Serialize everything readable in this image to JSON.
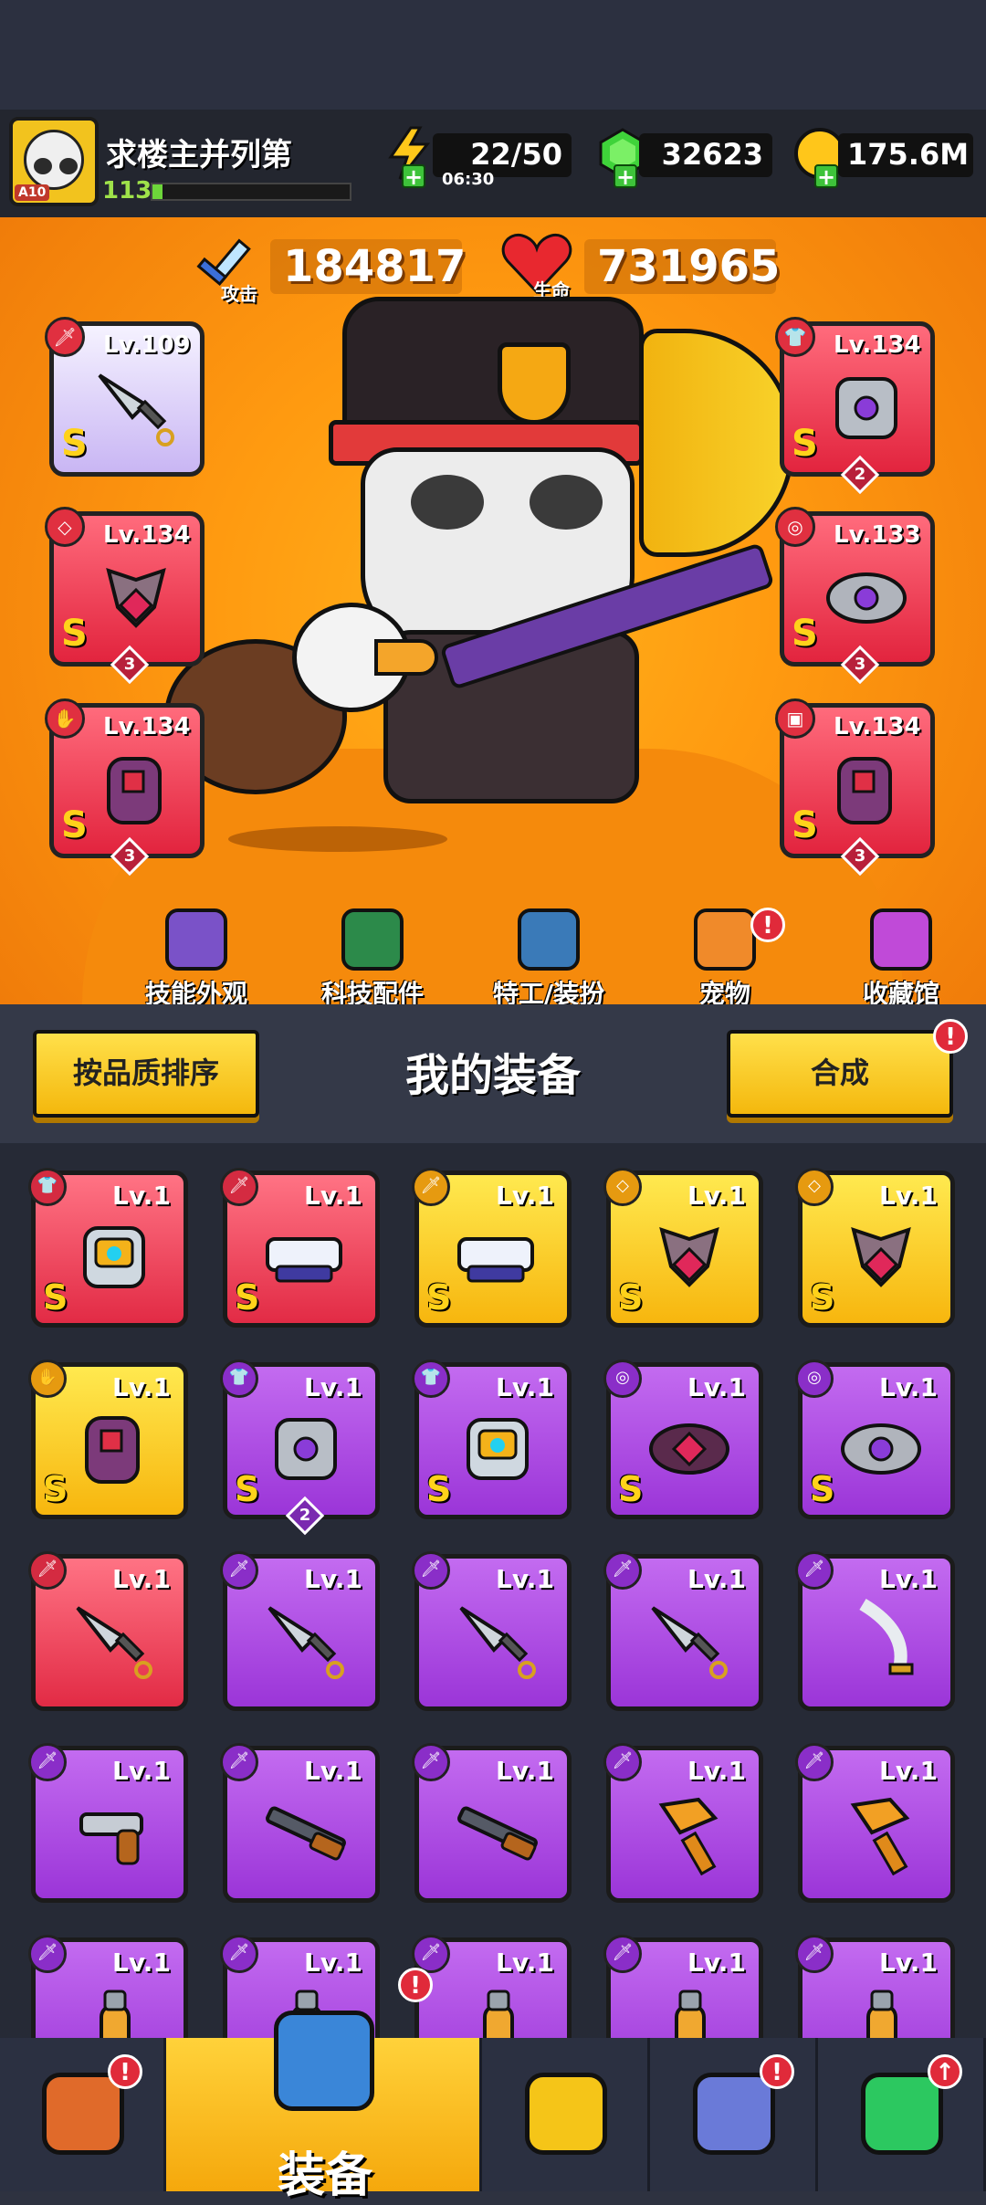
{
  "player": {
    "avatar_badge": "A10",
    "name": "求楼主并列第",
    "level": "113",
    "xp_fraction": 0.05
  },
  "resources": {
    "energy": {
      "value": "22/50",
      "timer": "06:30",
      "icon": "lightning-icon"
    },
    "gems": {
      "value": "32623",
      "icon": "green-gem-icon"
    },
    "gold": {
      "value": "175.6M",
      "icon": "gold-coin-icon"
    }
  },
  "stats": {
    "attack": {
      "label": "攻击",
      "value": "184817"
    },
    "hp": {
      "label": "生命",
      "value": "731965"
    }
  },
  "equipped": {
    "left": [
      {
        "lv": "Lv.109",
        "grade": "S",
        "slot": "weapon",
        "frame": "white"
      },
      {
        "lv": "Lv.134",
        "grade": "S",
        "slot": "necklace",
        "frame": "red",
        "count": "3"
      },
      {
        "lv": "Lv.134",
        "grade": "S",
        "slot": "glove",
        "frame": "red",
        "count": "3"
      }
    ],
    "right": [
      {
        "lv": "Lv.134",
        "grade": "S",
        "slot": "armor",
        "frame": "red",
        "count": "2"
      },
      {
        "lv": "Lv.133",
        "grade": "S",
        "slot": "belt",
        "frame": "red",
        "count": "3"
      },
      {
        "lv": "Lv.134",
        "grade": "S",
        "slot": "boots",
        "frame": "red",
        "count": "3"
      }
    ]
  },
  "hero_menu": [
    {
      "label": "技能外观",
      "icon": "skill-skin-icon",
      "badge": ""
    },
    {
      "label": "科技配件",
      "icon": "tech-part-icon",
      "badge": ""
    },
    {
      "label": "特工/装扮",
      "icon": "agent-costume-icon",
      "badge": ""
    },
    {
      "label": "宠物",
      "icon": "pet-shiba-icon",
      "badge": "!"
    },
    {
      "label": "收藏馆",
      "icon": "collection-chest-icon",
      "badge": ""
    }
  ],
  "inventory_header": {
    "sort_label": "按品质排序",
    "title": "我的装备",
    "merge_label": "合成",
    "merge_badge": "!"
  },
  "inventory": [
    {
      "lv": "Lv.1",
      "grade": "S",
      "color": "red",
      "slot": "armor",
      "art": "armor"
    },
    {
      "lv": "Lv.1",
      "grade": "S",
      "color": "red",
      "slot": "weapon",
      "art": "blaster"
    },
    {
      "lv": "Lv.1",
      "grade": "S",
      "color": "yellow",
      "slot": "weapon",
      "art": "blaster"
    },
    {
      "lv": "Lv.1",
      "grade": "S",
      "color": "yellow",
      "slot": "necklace",
      "art": "necklace"
    },
    {
      "lv": "Lv.1",
      "grade": "S",
      "color": "yellow",
      "slot": "necklace",
      "art": "necklace"
    },
    {
      "lv": "Lv.1",
      "grade": "S",
      "color": "yellow",
      "slot": "glove",
      "art": "glove"
    },
    {
      "lv": "Lv.1",
      "grade": "S",
      "color": "purple",
      "slot": "armor",
      "art": "armor-grey",
      "count": "2"
    },
    {
      "lv": "Lv.1",
      "grade": "S",
      "color": "purple",
      "slot": "armor",
      "art": "armor"
    },
    {
      "lv": "Lv.1",
      "grade": "S",
      "color": "purple",
      "slot": "belt",
      "art": "belt"
    },
    {
      "lv": "Lv.1",
      "grade": "S",
      "color": "purple",
      "slot": "belt",
      "art": "belt-grey"
    },
    {
      "lv": "Lv.1",
      "grade": "",
      "color": "red",
      "slot": "weapon",
      "art": "kunai"
    },
    {
      "lv": "Lv.1",
      "grade": "",
      "color": "purple",
      "slot": "weapon",
      "art": "kunai"
    },
    {
      "lv": "Lv.1",
      "grade": "",
      "color": "purple",
      "slot": "weapon",
      "art": "kunai"
    },
    {
      "lv": "Lv.1",
      "grade": "",
      "color": "purple",
      "slot": "weapon",
      "art": "kunai"
    },
    {
      "lv": "Lv.1",
      "grade": "",
      "color": "purple",
      "slot": "weapon",
      "art": "sword"
    },
    {
      "lv": "Lv.1",
      "grade": "",
      "color": "purple",
      "slot": "weapon",
      "art": "revolver"
    },
    {
      "lv": "Lv.1",
      "grade": "",
      "color": "purple",
      "slot": "weapon",
      "art": "shotgun"
    },
    {
      "lv": "Lv.1",
      "grade": "",
      "color": "purple",
      "slot": "weapon",
      "art": "shotgun"
    },
    {
      "lv": "Lv.1",
      "grade": "",
      "color": "purple",
      "slot": "weapon",
      "art": "drill"
    },
    {
      "lv": "Lv.1",
      "grade": "",
      "color": "purple",
      "slot": "weapon",
      "art": "drill"
    },
    {
      "lv": "Lv.1",
      "grade": "",
      "color": "purple",
      "slot": "weapon",
      "art": "bat"
    },
    {
      "lv": "Lv.1",
      "grade": "",
      "color": "purple",
      "slot": "weapon",
      "art": "bat"
    },
    {
      "lv": "Lv.1",
      "grade": "",
      "color": "purple",
      "slot": "weapon",
      "art": "bat"
    },
    {
      "lv": "Lv.1",
      "grade": "",
      "color": "purple",
      "slot": "weapon",
      "art": "bat"
    },
    {
      "lv": "Lv.1",
      "grade": "",
      "color": "purple",
      "slot": "weapon",
      "art": "bat"
    }
  ],
  "tabs": [
    {
      "name": "shop",
      "icon": "shop-icon",
      "badge": "!"
    },
    {
      "name": "equipment",
      "label": "装备",
      "icon": "equipment-bag-icon",
      "badge": "!",
      "active": true
    },
    {
      "name": "battle",
      "icon": "crossed-swords-star-icon",
      "badge": ""
    },
    {
      "name": "eggs",
      "icon": "egg-icon",
      "badge": "!"
    },
    {
      "name": "evolution",
      "icon": "dna-capsule-icon",
      "badge": "↑"
    }
  ],
  "colors": {
    "hero_bg": "#ff9a10",
    "red_frame": "#e22b45",
    "yellow_frame": "#f7b60e",
    "purple_frame": "#9b35d8",
    "accent_yellow": "#ffd21a"
  }
}
